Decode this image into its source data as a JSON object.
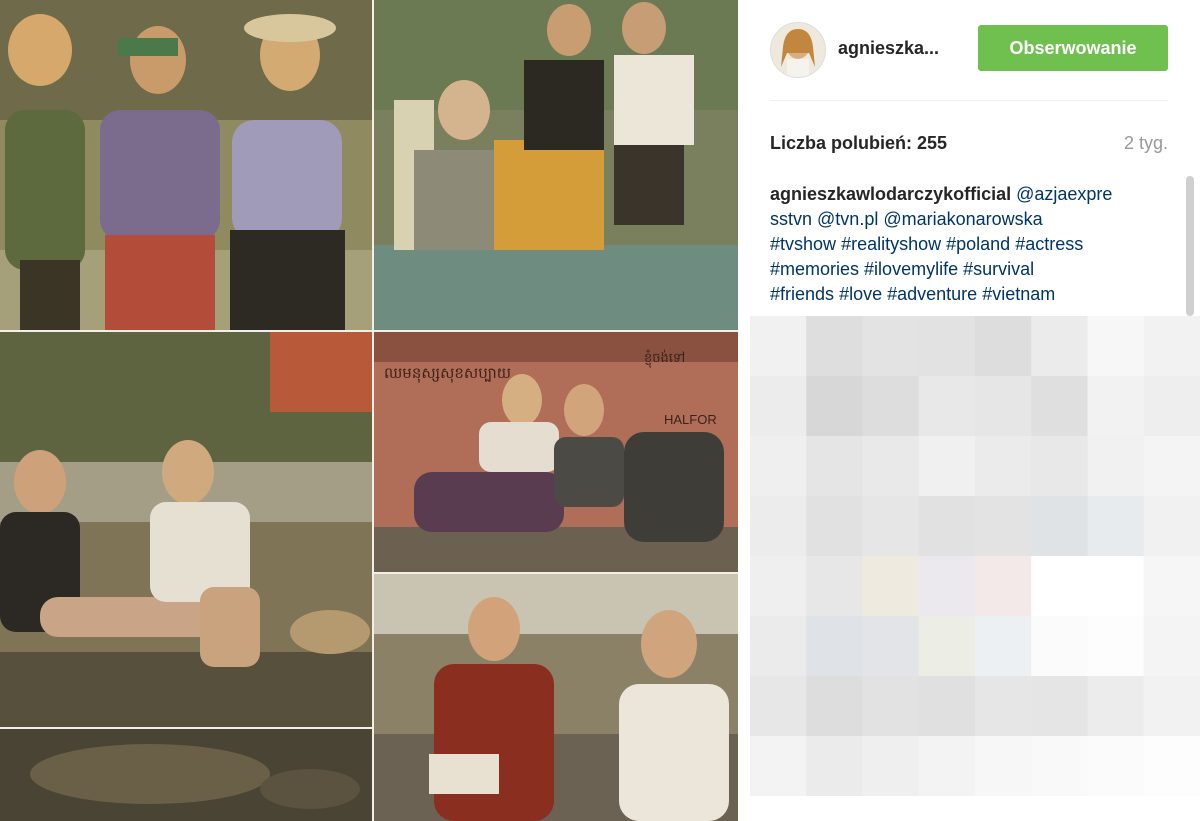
{
  "post": {
    "username": "agnieszka...",
    "follow_label": "Obserwowanie",
    "likes_label": "Liczba polubień: 255",
    "time_ago": "2 tyg.",
    "caption": {
      "author": "agnieszkawlodarczykofficial",
      "text_parts": [
        "@azjaexpre",
        "sstvn",
        "@tvn.pl",
        "@mariakonarowska",
        "#tvshow",
        "#realityshow",
        "#poland",
        "#actress",
        "#memories",
        "#ilovemylife",
        "#survival",
        "#friends",
        "#love",
        "#adventure",
        "#vietnam"
      ]
    }
  },
  "photo_signs": {
    "sign_a": "ឈមនុស្សសុខសប្បាយ",
    "sign_b": "ខ្ញុំចង់ទៅ",
    "sign_c": "HALFOR"
  },
  "colors": {
    "follow_green": "#70c050",
    "username": "#262626",
    "caption_link": "#003569",
    "time_gray": "#999999"
  },
  "icons": {
    "avatar": "user-avatar"
  }
}
